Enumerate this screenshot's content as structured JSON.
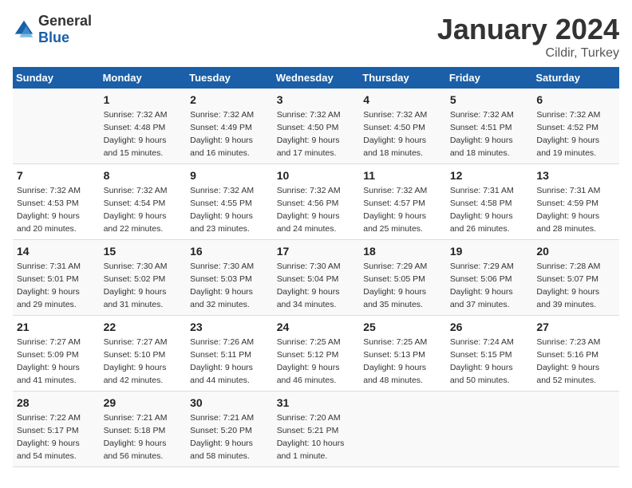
{
  "logo": {
    "general": "General",
    "blue": "Blue"
  },
  "header": {
    "month": "January 2024",
    "location": "Cildir, Turkey"
  },
  "weekdays": [
    "Sunday",
    "Monday",
    "Tuesday",
    "Wednesday",
    "Thursday",
    "Friday",
    "Saturday"
  ],
  "weeks": [
    [
      {
        "day": "",
        "sunrise": "",
        "sunset": "",
        "daylight": ""
      },
      {
        "day": "1",
        "sunrise": "Sunrise: 7:32 AM",
        "sunset": "Sunset: 4:48 PM",
        "daylight": "Daylight: 9 hours and 15 minutes."
      },
      {
        "day": "2",
        "sunrise": "Sunrise: 7:32 AM",
        "sunset": "Sunset: 4:49 PM",
        "daylight": "Daylight: 9 hours and 16 minutes."
      },
      {
        "day": "3",
        "sunrise": "Sunrise: 7:32 AM",
        "sunset": "Sunset: 4:50 PM",
        "daylight": "Daylight: 9 hours and 17 minutes."
      },
      {
        "day": "4",
        "sunrise": "Sunrise: 7:32 AM",
        "sunset": "Sunset: 4:50 PM",
        "daylight": "Daylight: 9 hours and 18 minutes."
      },
      {
        "day": "5",
        "sunrise": "Sunrise: 7:32 AM",
        "sunset": "Sunset: 4:51 PM",
        "daylight": "Daylight: 9 hours and 18 minutes."
      },
      {
        "day": "6",
        "sunrise": "Sunrise: 7:32 AM",
        "sunset": "Sunset: 4:52 PM",
        "daylight": "Daylight: 9 hours and 19 minutes."
      }
    ],
    [
      {
        "day": "7",
        "sunrise": "Sunrise: 7:32 AM",
        "sunset": "Sunset: 4:53 PM",
        "daylight": "Daylight: 9 hours and 20 minutes."
      },
      {
        "day": "8",
        "sunrise": "Sunrise: 7:32 AM",
        "sunset": "Sunset: 4:54 PM",
        "daylight": "Daylight: 9 hours and 22 minutes."
      },
      {
        "day": "9",
        "sunrise": "Sunrise: 7:32 AM",
        "sunset": "Sunset: 4:55 PM",
        "daylight": "Daylight: 9 hours and 23 minutes."
      },
      {
        "day": "10",
        "sunrise": "Sunrise: 7:32 AM",
        "sunset": "Sunset: 4:56 PM",
        "daylight": "Daylight: 9 hours and 24 minutes."
      },
      {
        "day": "11",
        "sunrise": "Sunrise: 7:32 AM",
        "sunset": "Sunset: 4:57 PM",
        "daylight": "Daylight: 9 hours and 25 minutes."
      },
      {
        "day": "12",
        "sunrise": "Sunrise: 7:31 AM",
        "sunset": "Sunset: 4:58 PM",
        "daylight": "Daylight: 9 hours and 26 minutes."
      },
      {
        "day": "13",
        "sunrise": "Sunrise: 7:31 AM",
        "sunset": "Sunset: 4:59 PM",
        "daylight": "Daylight: 9 hours and 28 minutes."
      }
    ],
    [
      {
        "day": "14",
        "sunrise": "Sunrise: 7:31 AM",
        "sunset": "Sunset: 5:01 PM",
        "daylight": "Daylight: 9 hours and 29 minutes."
      },
      {
        "day": "15",
        "sunrise": "Sunrise: 7:30 AM",
        "sunset": "Sunset: 5:02 PM",
        "daylight": "Daylight: 9 hours and 31 minutes."
      },
      {
        "day": "16",
        "sunrise": "Sunrise: 7:30 AM",
        "sunset": "Sunset: 5:03 PM",
        "daylight": "Daylight: 9 hours and 32 minutes."
      },
      {
        "day": "17",
        "sunrise": "Sunrise: 7:30 AM",
        "sunset": "Sunset: 5:04 PM",
        "daylight": "Daylight: 9 hours and 34 minutes."
      },
      {
        "day": "18",
        "sunrise": "Sunrise: 7:29 AM",
        "sunset": "Sunset: 5:05 PM",
        "daylight": "Daylight: 9 hours and 35 minutes."
      },
      {
        "day": "19",
        "sunrise": "Sunrise: 7:29 AM",
        "sunset": "Sunset: 5:06 PM",
        "daylight": "Daylight: 9 hours and 37 minutes."
      },
      {
        "day": "20",
        "sunrise": "Sunrise: 7:28 AM",
        "sunset": "Sunset: 5:07 PM",
        "daylight": "Daylight: 9 hours and 39 minutes."
      }
    ],
    [
      {
        "day": "21",
        "sunrise": "Sunrise: 7:27 AM",
        "sunset": "Sunset: 5:09 PM",
        "daylight": "Daylight: 9 hours and 41 minutes."
      },
      {
        "day": "22",
        "sunrise": "Sunrise: 7:27 AM",
        "sunset": "Sunset: 5:10 PM",
        "daylight": "Daylight: 9 hours and 42 minutes."
      },
      {
        "day": "23",
        "sunrise": "Sunrise: 7:26 AM",
        "sunset": "Sunset: 5:11 PM",
        "daylight": "Daylight: 9 hours and 44 minutes."
      },
      {
        "day": "24",
        "sunrise": "Sunrise: 7:25 AM",
        "sunset": "Sunset: 5:12 PM",
        "daylight": "Daylight: 9 hours and 46 minutes."
      },
      {
        "day": "25",
        "sunrise": "Sunrise: 7:25 AM",
        "sunset": "Sunset: 5:13 PM",
        "daylight": "Daylight: 9 hours and 48 minutes."
      },
      {
        "day": "26",
        "sunrise": "Sunrise: 7:24 AM",
        "sunset": "Sunset: 5:15 PM",
        "daylight": "Daylight: 9 hours and 50 minutes."
      },
      {
        "day": "27",
        "sunrise": "Sunrise: 7:23 AM",
        "sunset": "Sunset: 5:16 PM",
        "daylight": "Daylight: 9 hours and 52 minutes."
      }
    ],
    [
      {
        "day": "28",
        "sunrise": "Sunrise: 7:22 AM",
        "sunset": "Sunset: 5:17 PM",
        "daylight": "Daylight: 9 hours and 54 minutes."
      },
      {
        "day": "29",
        "sunrise": "Sunrise: 7:21 AM",
        "sunset": "Sunset: 5:18 PM",
        "daylight": "Daylight: 9 hours and 56 minutes."
      },
      {
        "day": "30",
        "sunrise": "Sunrise: 7:21 AM",
        "sunset": "Sunset: 5:20 PM",
        "daylight": "Daylight: 9 hours and 58 minutes."
      },
      {
        "day": "31",
        "sunrise": "Sunrise: 7:20 AM",
        "sunset": "Sunset: 5:21 PM",
        "daylight": "Daylight: 10 hours and 1 minute."
      },
      {
        "day": "",
        "sunrise": "",
        "sunset": "",
        "daylight": ""
      },
      {
        "day": "",
        "sunrise": "",
        "sunset": "",
        "daylight": ""
      },
      {
        "day": "",
        "sunrise": "",
        "sunset": "",
        "daylight": ""
      }
    ]
  ]
}
